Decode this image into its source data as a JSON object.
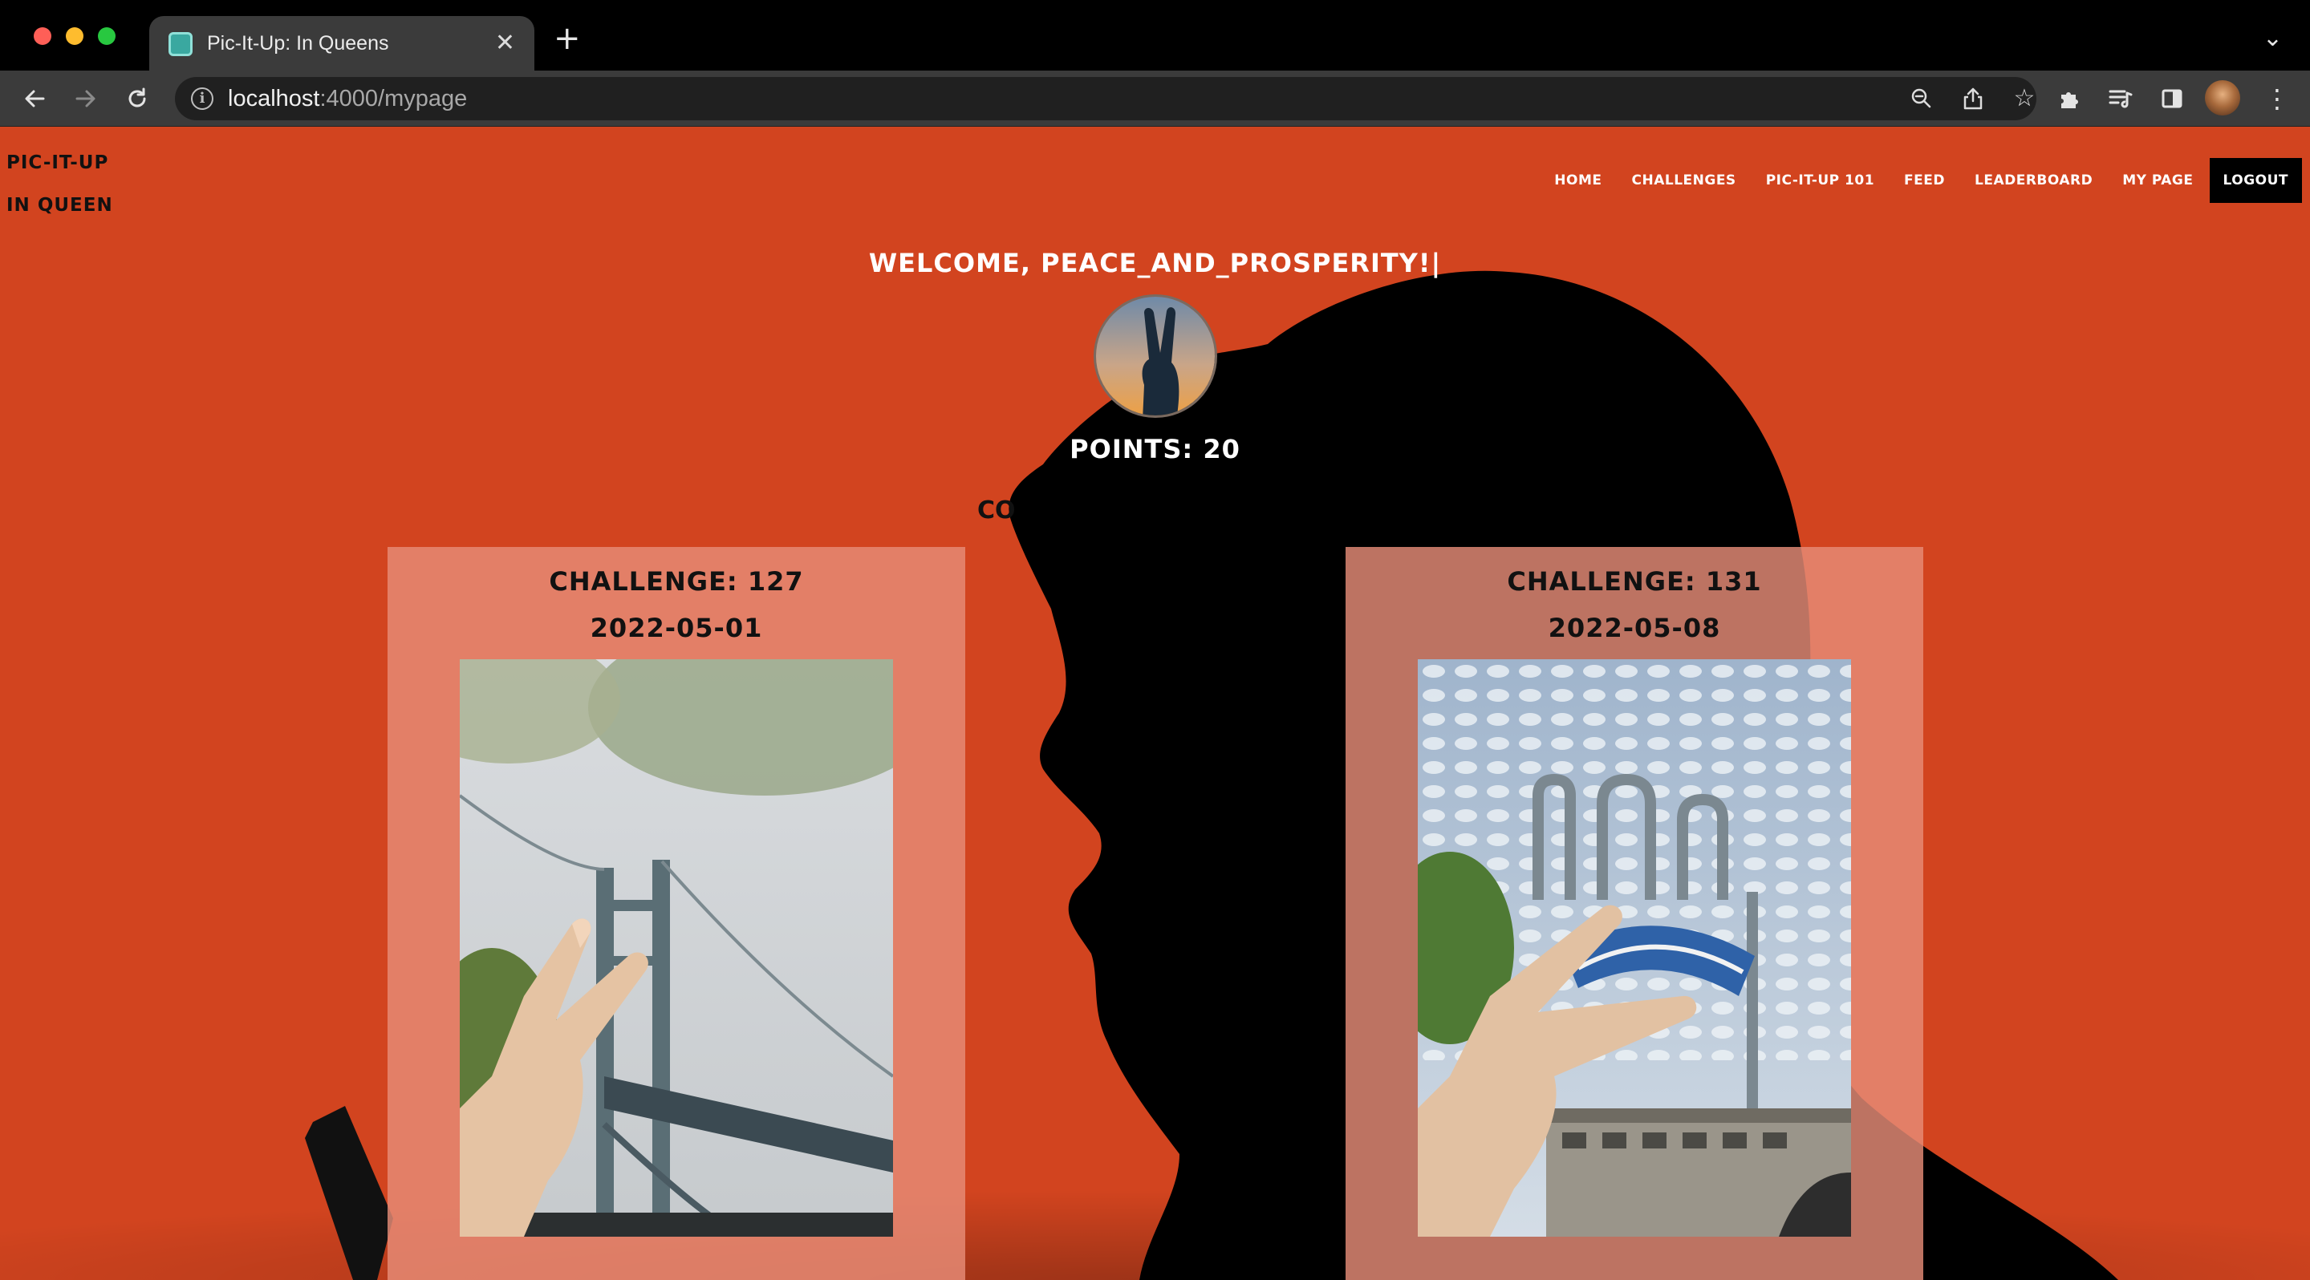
{
  "browser": {
    "tab_title": "Pic-It-Up: In Queens",
    "url_host": "localhost",
    "url_rest": ":4000/mypage"
  },
  "site": {
    "brand_line1": "PIC-IT-UP",
    "brand_line2": "IN QUEEN",
    "nav": {
      "home": "HOME",
      "challenges": "CHALLENGES",
      "pic101": "PIC-IT-UP 101",
      "feed": "FEED",
      "leaderboard": "LEADERBOARD",
      "mypage": "MY PAGE",
      "logout": "LOGOUT"
    },
    "welcome": "WELCOME, PEACE_AND_PROSPERITY!|",
    "points": "POINTS: 20",
    "section_peek": "CO",
    "cards": [
      {
        "challenge": "CHALLENGE: 127",
        "date": "2022-05-01"
      },
      {
        "challenge": "CHALLENGE: 131",
        "date": "2022-05-08"
      }
    ]
  },
  "colors": {
    "page_bg": "#d2441f",
    "card_bg": "#e78c78",
    "nav_logout_bg": "#000000"
  },
  "icons": [
    "back-icon",
    "forward-icon",
    "reload-icon",
    "info-icon",
    "zoom-icon",
    "share-icon",
    "bookmark-star-icon",
    "extensions-icon",
    "reading-list-icon",
    "side-panel-icon",
    "kebab-menu-icon",
    "close-icon",
    "plus-icon",
    "chevron-down-icon"
  ]
}
